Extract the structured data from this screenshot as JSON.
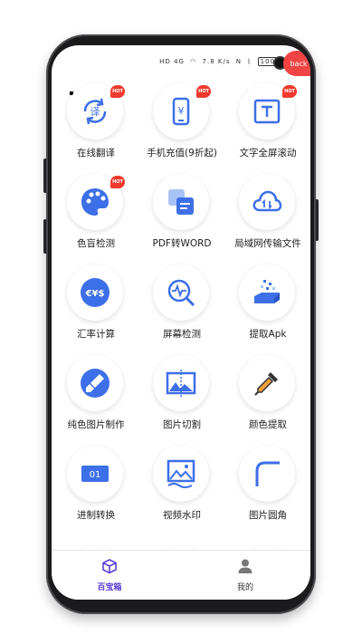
{
  "status_bar": {
    "left_icons": "HD 4G",
    "speed": "7.8 K/s",
    "battery": "100",
    "back_label": "back"
  },
  "tools": [
    {
      "label": "在线翻译",
      "icon": "translate-icon",
      "hot": true
    },
    {
      "label": "手机充值(9折起)",
      "icon": "phone-recharge-icon",
      "hot": true
    },
    {
      "label": "文字全屏滚动",
      "icon": "text-scroll-icon",
      "hot": true
    },
    {
      "label": "色盲检测",
      "icon": "palette-icon",
      "hot": true
    },
    {
      "label": "PDF转WORD",
      "icon": "pdf-to-word-icon",
      "hot": false
    },
    {
      "label": "局域网传输文件",
      "icon": "cloud-transfer-icon",
      "hot": false
    },
    {
      "label": "汇率计算",
      "icon": "currency-icon",
      "hot": false
    },
    {
      "label": "屏幕检测",
      "icon": "screen-check-icon",
      "hot": false
    },
    {
      "label": "提取Apk",
      "icon": "extract-apk-icon",
      "hot": false
    },
    {
      "label": "纯色图片制作",
      "icon": "paint-brush-icon",
      "hot": false
    },
    {
      "label": "图片切割",
      "icon": "image-split-icon",
      "hot": false
    },
    {
      "label": "颜色提取",
      "icon": "color-dropper-icon",
      "hot": false
    },
    {
      "label": "进制转换",
      "icon": "base-convert-icon",
      "hot": false
    },
    {
      "label": "视频水印",
      "icon": "video-watermark-icon",
      "hot": false
    },
    {
      "label": "图片圆角",
      "icon": "round-corner-icon",
      "hot": false
    }
  ],
  "hot_badge": "HOT",
  "base_convert_text": "01",
  "nav": {
    "toolbox_label": "百宝箱",
    "mine_label": "我的"
  },
  "colors": {
    "accent": "#3d6fe8",
    "nav_active": "#5b3fd6",
    "hot": "#f03a2e"
  }
}
